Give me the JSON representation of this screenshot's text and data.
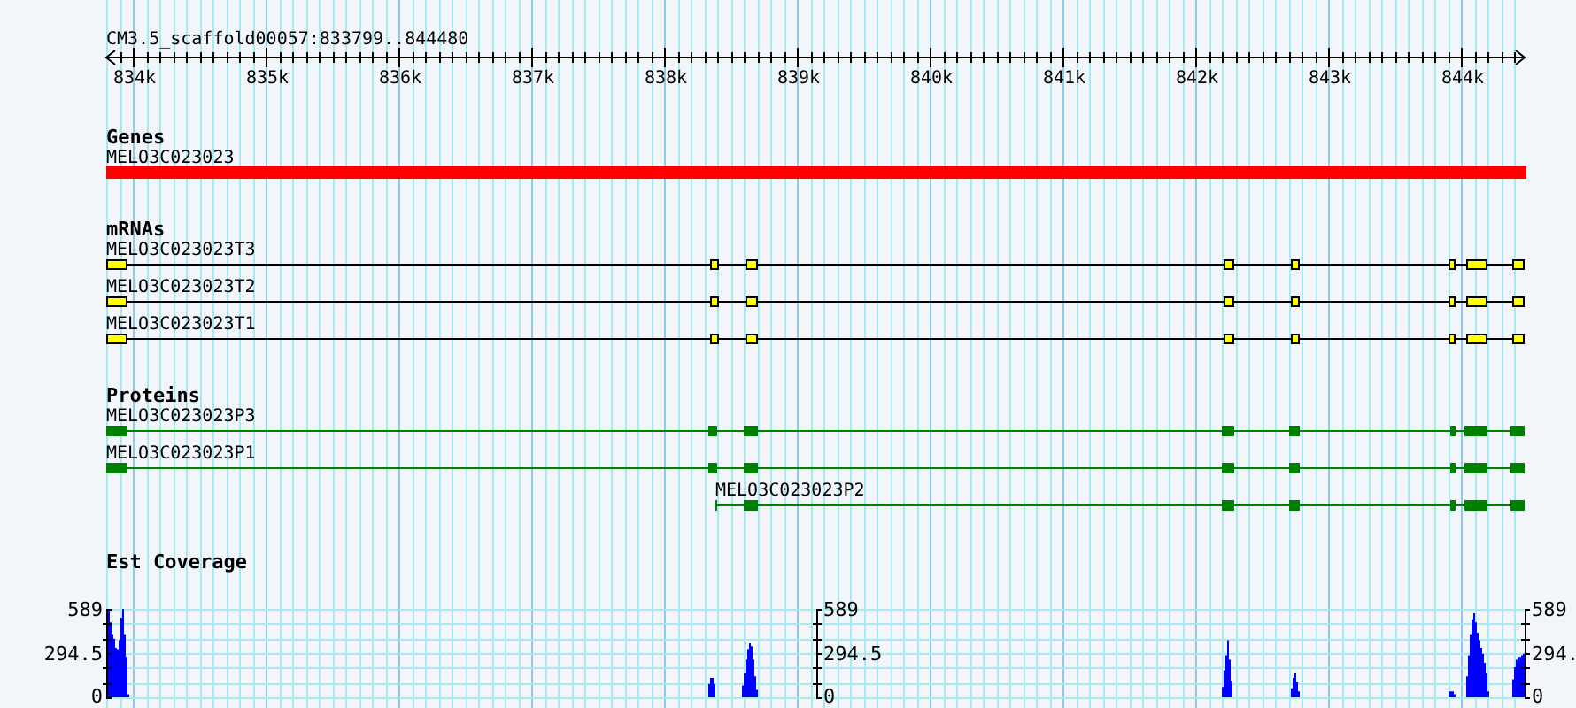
{
  "title": "CM3.5_scaffold00057:833799..844480",
  "ruler": {
    "ticks": [
      "834k",
      "835k",
      "836k",
      "837k",
      "838k",
      "839k",
      "840k",
      "841k",
      "842k",
      "843k",
      "844k"
    ]
  },
  "tracks": [
    {
      "kind": "gene",
      "title": "Genes",
      "features": [
        {
          "name": "MELO3C023023"
        }
      ]
    },
    {
      "kind": "mrna",
      "title": "mRNAs",
      "features": [
        {
          "name": "MELO3C023023T3"
        },
        {
          "name": "MELO3C023023T2"
        },
        {
          "name": "MELO3C023023T1"
        }
      ]
    },
    {
      "kind": "protein",
      "title": "Proteins",
      "features": [
        {
          "name": "MELO3C023023P3"
        },
        {
          "name": "MELO3C023023P1"
        },
        {
          "name": "MELO3C023023P2"
        }
      ]
    },
    {
      "kind": "coverage",
      "title": "Est Coverage",
      "panels": [
        {
          "labels": [
            "589",
            "294.5",
            "0"
          ]
        },
        {
          "labels": [
            "589",
            "294.5",
            "0"
          ]
        },
        {
          "labels": [
            "589",
            "294.",
            "0"
          ]
        }
      ]
    }
  ]
}
